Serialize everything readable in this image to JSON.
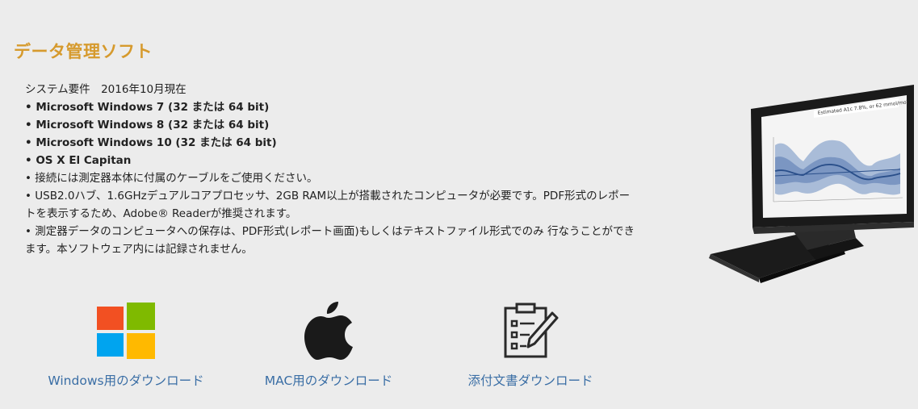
{
  "page": {
    "title": "データ管理ソフト"
  },
  "requirements": {
    "heading": "システム要件　2016年10月現在",
    "os": [
      "• Microsoft Windows 7 (32 または 64 bit)",
      "• Microsoft Windows 8 (32 または 64 bit)",
      "• Microsoft Windows 10 (32 または 64 bit)",
      "• OS X El Capitan"
    ],
    "notes": [
      "• 接続には測定器本体に付属のケーブルをご使用ください。",
      "• USB2.0ハブ、1.6GHzデュアルコアプロセッサ、2GB RAM以上が搭載されたコンピュータが必要です。PDF形式のレポートを表示するため、Adobe® Readerが推奨されます。",
      "• 測定器データのコンピュータへの保存は、PDF形式(レポート画面)もしくはテキストファイル形式でのみ 行なうことができます。本ソフトウェア内には記録されません。"
    ]
  },
  "monitor": {
    "screen_text": "Estimated A1c 7.8%, or 62 mmol/mol"
  },
  "downloads": [
    {
      "label": "Windows用のダウンロード",
      "icon": "windows-logo-icon"
    },
    {
      "label": "MAC用のダウンロード",
      "icon": "apple-logo-icon"
    },
    {
      "label": "添付文書ダウンロード",
      "icon": "clipboard-edit-icon"
    }
  ],
  "colors": {
    "title": "#d69a2d",
    "link": "#3a6ea5",
    "background": "#ececec",
    "win_red": "#f25022",
    "win_green": "#7fba00",
    "win_blue": "#00a4ef",
    "win_yellow": "#ffb900"
  }
}
